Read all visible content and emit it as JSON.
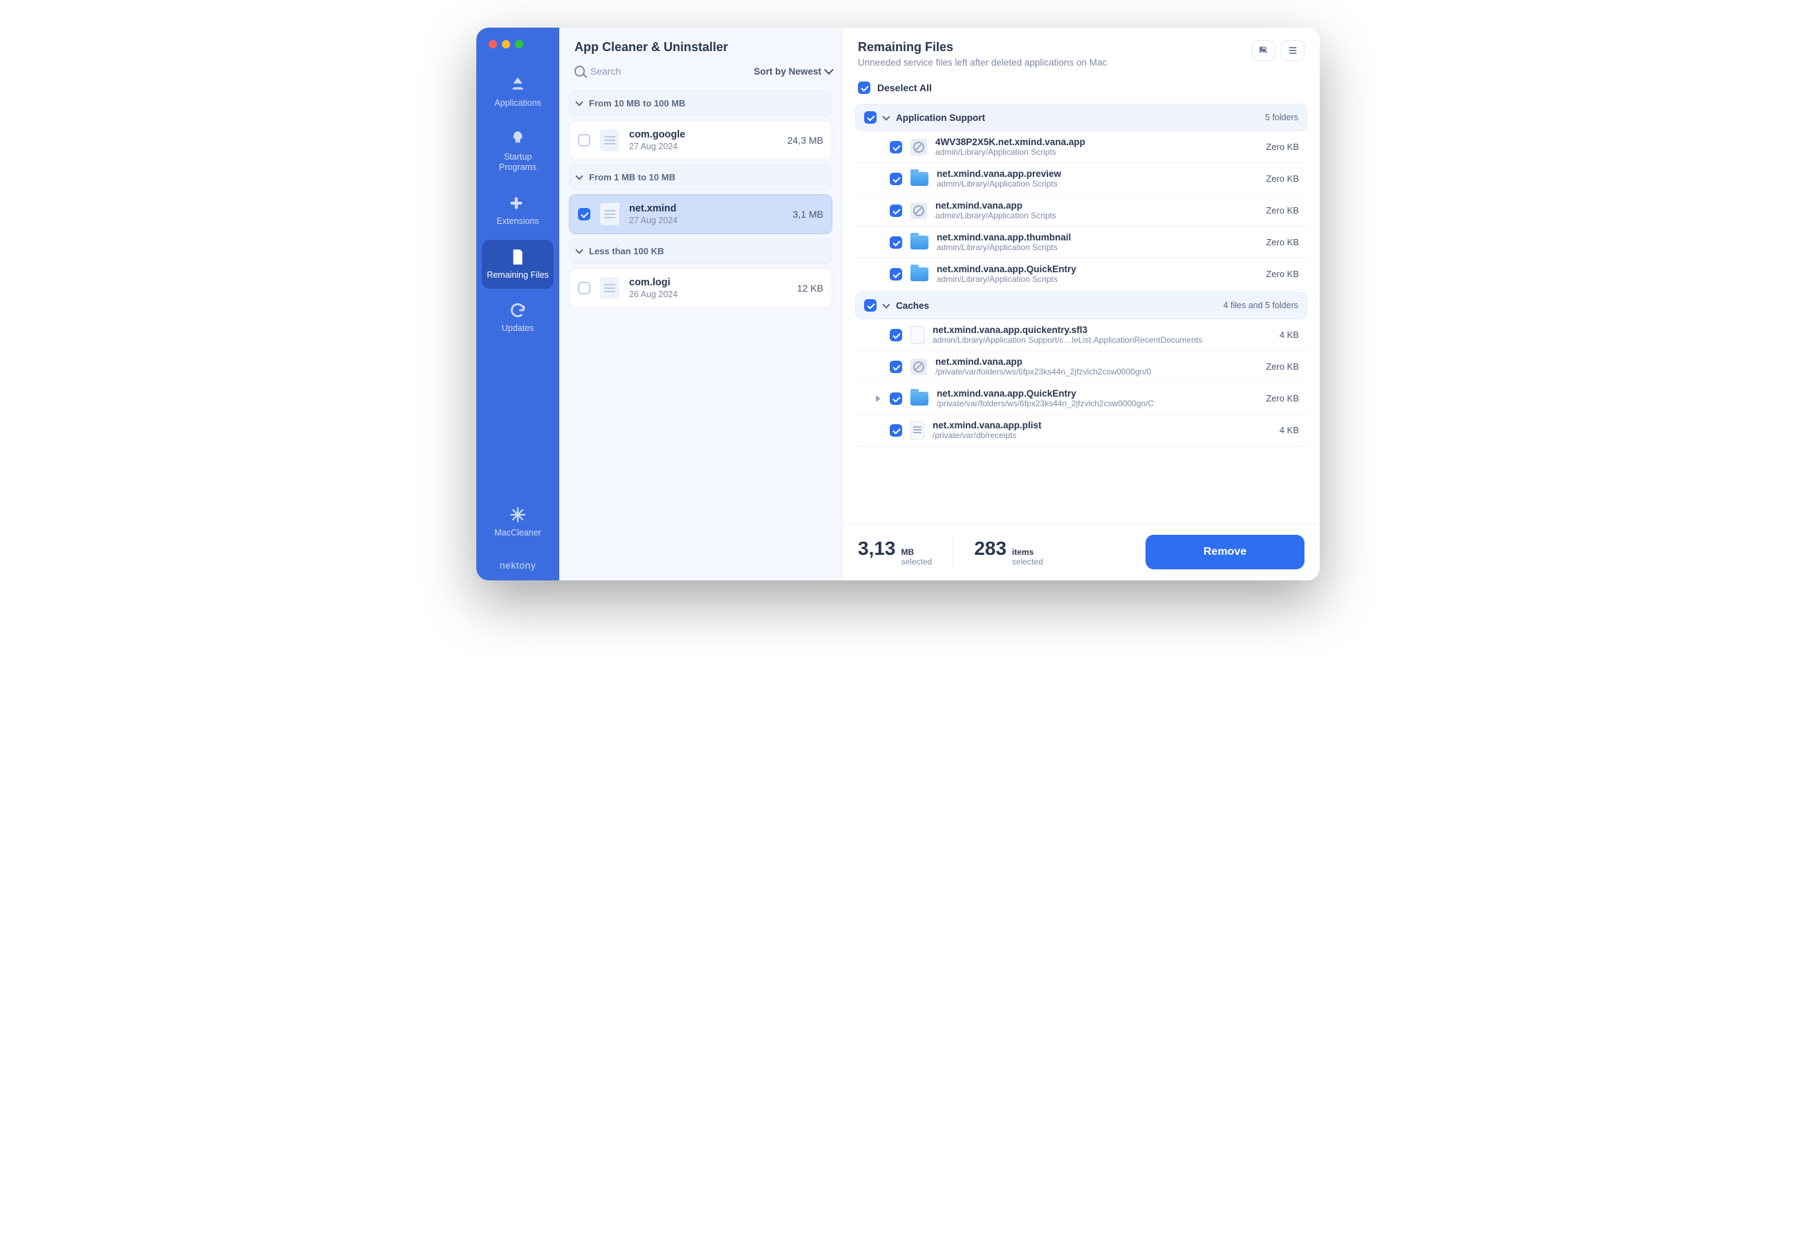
{
  "header": {
    "title": "App Cleaner & Uninstaller"
  },
  "sidebar": {
    "items": [
      {
        "label": "Applications"
      },
      {
        "label": "Startup Programs"
      },
      {
        "label": "Extensions"
      },
      {
        "label": "Remaining Files"
      },
      {
        "label": "Updates"
      }
    ],
    "maccleaner": "MacCleaner",
    "brand": "nektony"
  },
  "search": {
    "placeholder": "Search"
  },
  "sort": {
    "label": "Sort by Newest"
  },
  "groups": [
    {
      "title": "From 10 MB to 100 MB",
      "apps": [
        {
          "name": "com.google",
          "date": "27 Aug 2024",
          "size": "24,3 MB",
          "checked": false,
          "selected": false
        }
      ]
    },
    {
      "title": "From 1 MB to 10 MB",
      "apps": [
        {
          "name": "net.xmind",
          "date": "27 Aug 2024",
          "size": "3,1 MB",
          "checked": true,
          "selected": true
        }
      ]
    },
    {
      "title": "Less than 100 KB",
      "apps": [
        {
          "name": "com.logi",
          "date": "26 Aug 2024",
          "size": "12 KB",
          "checked": false,
          "selected": false
        }
      ]
    }
  ],
  "right": {
    "title": "Remaining Files",
    "subtitle": "Unneeded service files left after deleted applications on Mac",
    "deselect": "Deselect All"
  },
  "categories": [
    {
      "name": "Application Support",
      "summary": "5 folders",
      "files": [
        {
          "name": "4WV38P2X5K.net.xmind.vana.app",
          "path": "admin/Library/Application Scripts",
          "size": "Zero KB",
          "icon": "blocked"
        },
        {
          "name": "net.xmind.vana.app.preview",
          "path": "admin/Library/Application Scripts",
          "size": "Zero KB",
          "icon": "folder"
        },
        {
          "name": "net.xmind.vana.app",
          "path": "admin/Library/Application Scripts",
          "size": "Zero KB",
          "icon": "blocked"
        },
        {
          "name": "net.xmind.vana.app.thumbnail",
          "path": "admin/Library/Application Scripts",
          "size": "Zero KB",
          "icon": "folder"
        },
        {
          "name": "net.xmind.vana.app.QuickEntry",
          "path": "admin/Library/Application Scripts",
          "size": "Zero KB",
          "icon": "folder"
        }
      ]
    },
    {
      "name": "Caches",
      "summary": "4 files and 5 folders",
      "files": [
        {
          "name": "net.xmind.vana.app.quickentry.sfl3",
          "path": "admin/Library/Application Support/c…leList.ApplicationRecentDocuments",
          "size": "4 KB",
          "icon": "doc"
        },
        {
          "name": "net.xmind.vana.app",
          "path": "/private/var/folders/ws/6fpx23ks44n_2jfzvlch2csw0000gn/0",
          "size": "Zero KB",
          "icon": "blocked"
        },
        {
          "name": "net.xmind.vana.app.QuickEntry",
          "path": "/private/var/folders/ws/6fpx23ks44n_2jfzvlch2csw0000gn/C",
          "size": "Zero KB",
          "icon": "folder",
          "expandable": true
        },
        {
          "name": "net.xmind.vana.app.plist",
          "path": "/private/var/db/receipts",
          "size": "4 KB",
          "icon": "plist"
        }
      ]
    }
  ],
  "footer": {
    "size_num": "3,13",
    "size_unit": "MB",
    "size_sub": "selected",
    "count_num": "283",
    "count_unit": "items",
    "count_sub": "selected",
    "remove": "Remove"
  }
}
